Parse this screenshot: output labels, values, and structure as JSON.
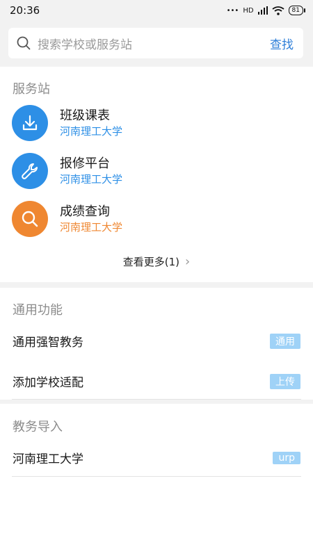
{
  "status": {
    "time": "20:36",
    "battery": "81",
    "network": "HD"
  },
  "search": {
    "placeholder": "搜索学校或服务站",
    "button": "查找"
  },
  "stations": {
    "title": "服务站",
    "items": [
      {
        "name": "班级课表",
        "school": "河南理工大学",
        "icon": "download-icon",
        "color": "#2d8fe6"
      },
      {
        "name": "报修平台",
        "school": "河南理工大学",
        "icon": "wrench-icon",
        "color": "#2d8fe6"
      },
      {
        "name": "成绩查询",
        "school": "河南理工大学",
        "icon": "search-icon",
        "color": "#ef8731"
      }
    ],
    "more": "查看更多(1)"
  },
  "general": {
    "title": "通用功能",
    "rows": [
      {
        "label": "通用强智教务",
        "tag": "通用"
      },
      {
        "label": "添加学校适配",
        "tag": "上传"
      }
    ]
  },
  "import": {
    "title": "教务导入",
    "rows": [
      {
        "label": "河南理工大学",
        "tag": "urp"
      }
    ]
  }
}
